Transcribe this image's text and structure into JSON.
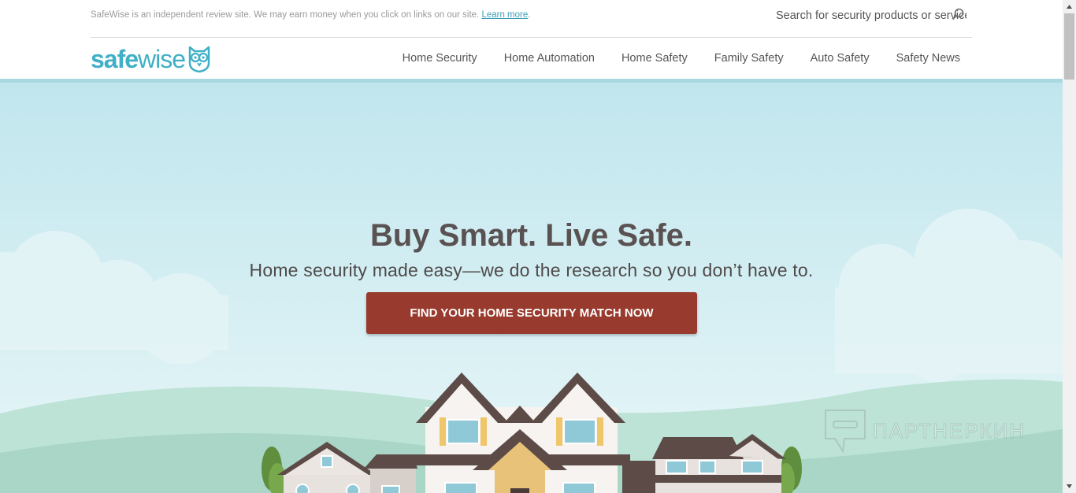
{
  "disclaimer": {
    "text": "SafeWise is an independent review site. We may earn money when you click on links on our site. ",
    "link": "Learn more",
    "after": "."
  },
  "search": {
    "placeholder": "Search for security products or services",
    "icon": "search-icon"
  },
  "logo": {
    "part1": "safe",
    "part2": "wise",
    "icon": "owl-icon"
  },
  "nav": {
    "items": [
      {
        "label": "Home Security"
      },
      {
        "label": "Home Automation"
      },
      {
        "label": "Home Safety"
      },
      {
        "label": "Family Safety"
      },
      {
        "label": "Auto Safety"
      },
      {
        "label": "Safety News"
      }
    ]
  },
  "hero": {
    "title": "Buy Smart. Live Safe.",
    "subtitle": "Home security made easy—we do the research so you don’t have to.",
    "cta_label": "FIND YOUR HOME SECURITY MATCH NOW"
  },
  "watermark": {
    "text": "ПАРТНЕРКИН",
    "icon": "chat-bubble-icon"
  },
  "colors": {
    "brand": "#3fb0c5",
    "cta": "#983a2d",
    "hero_sky": "#c0e6ed",
    "hills": "#a9d6c6"
  }
}
